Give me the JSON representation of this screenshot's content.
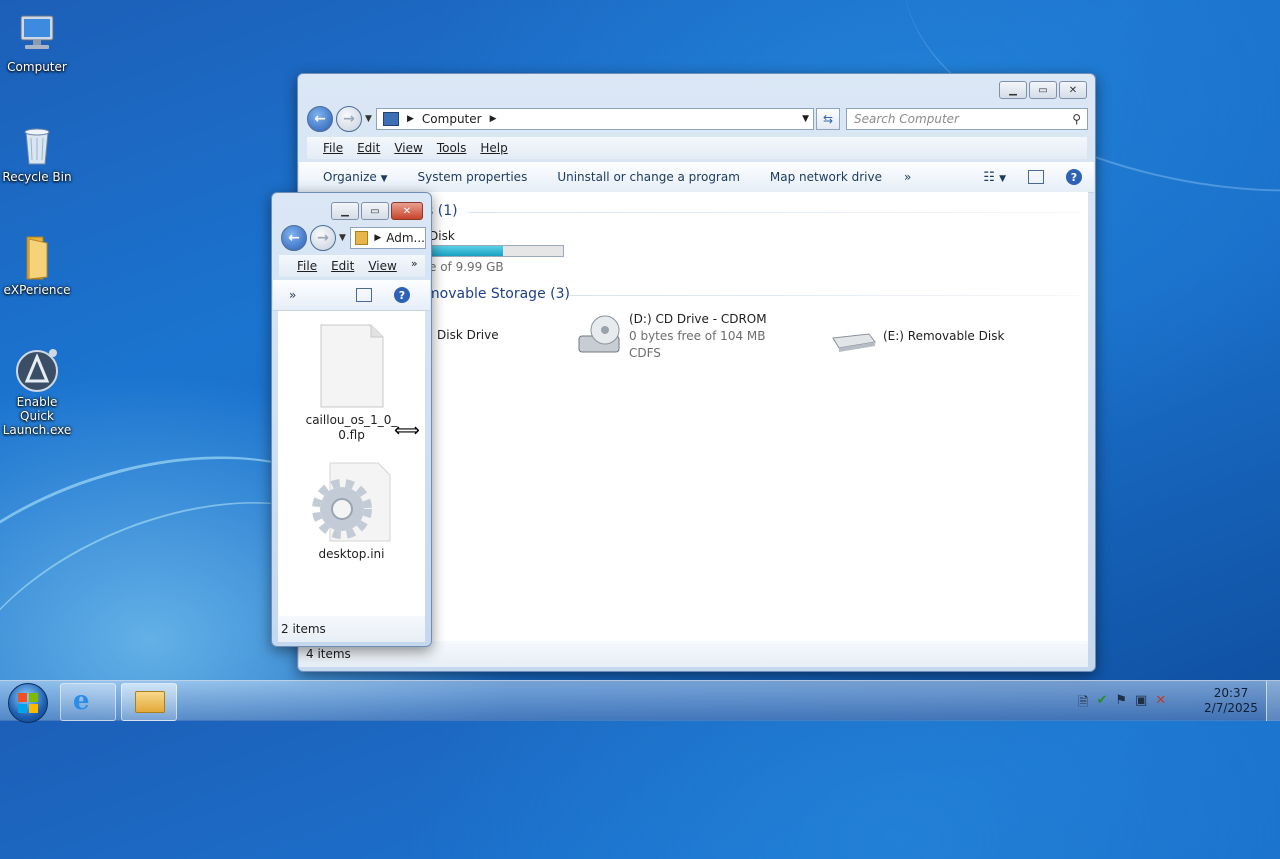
{
  "desktop": {
    "icons": [
      {
        "label": "Computer",
        "icon": "computer-icon"
      },
      {
        "label": "Recycle Bin",
        "icon": "recycle-bin-icon"
      },
      {
        "label": "eXPerience",
        "icon": "folder-icon"
      },
      {
        "label": "Enable Quick Launch.exe",
        "icon": "app-icon"
      }
    ]
  },
  "main_window": {
    "address": "Computer",
    "search_placeholder": "Search Computer",
    "menu": [
      "File",
      "Edit",
      "View",
      "Tools",
      "Help"
    ],
    "commands": [
      "Organize",
      "System properties",
      "Uninstall or change a program",
      "Map network drive",
      "»"
    ],
    "group_hard_disks": "s (1)",
    "disk_label": "Disk",
    "disk_free": "e of 9.99 GB",
    "disk_usage_fraction": 0.55,
    "group_removable": "movable Storage (3)",
    "floppy_label": "Disk Drive",
    "cd_drive": {
      "name": "(D:) CD Drive - CDROM",
      "free": "0 bytes free of 104 MB",
      "fs": "CDFS"
    },
    "removable_disk": "(E:) Removable Disk",
    "status": "4 items"
  },
  "small_window": {
    "address": "Adm...",
    "menu": [
      "File",
      "Edit",
      "View",
      "»"
    ],
    "chevron": "»",
    "files": [
      {
        "name": "caillou_os_1_0_0.flp",
        "icon": "blank-file-icon"
      },
      {
        "name": "desktop.ini",
        "icon": "settings-file-icon"
      }
    ],
    "status": "2 items"
  },
  "taskbar": {
    "time": "20:37",
    "date": "2/7/2025"
  }
}
